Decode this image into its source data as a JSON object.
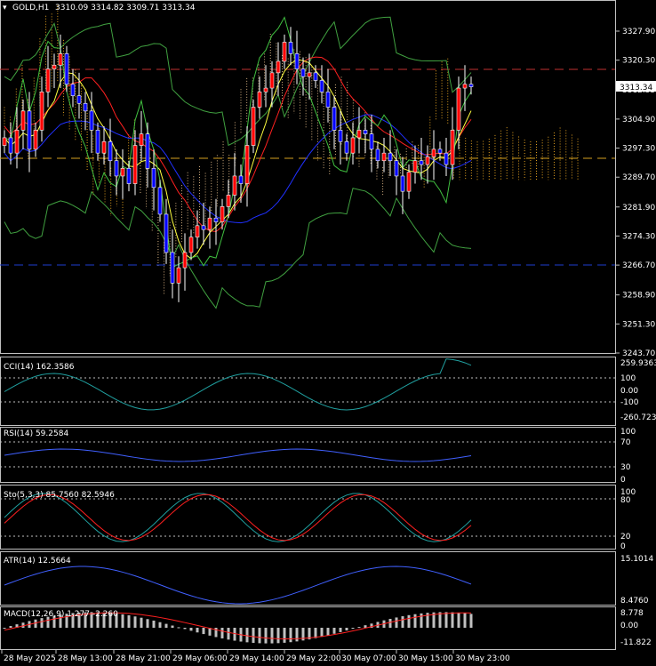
{
  "header": {
    "symbol": "GOLD,H1",
    "ohlc": "3310.09 3314.82 3309.71 3313.34"
  },
  "main_axis": {
    "ticks": [
      "3327.90",
      "3320.30",
      "3312.55",
      "3304.90",
      "3297.30",
      "3289.70",
      "3281.90",
      "3274.30",
      "3266.70",
      "3258.90",
      "3251.30",
      "3243.70"
    ],
    "current_price": "3313.34"
  },
  "indicators": {
    "cci": {
      "label": "CCI(14) 162.3586",
      "ticks": [
        "259.9363",
        "100",
        "0.00",
        "-100",
        "-260.7236"
      ]
    },
    "rsi": {
      "label": "RSI(14) 59.2584",
      "ticks": [
        "100",
        "70",
        "30",
        "0"
      ]
    },
    "stoch": {
      "label": "Sto(5,3,3) 85.7560 82.5946",
      "ticks": [
        "100",
        "80",
        "20",
        "0"
      ]
    },
    "atr": {
      "label": "ATR(14) 12.5664",
      "ticks": [
        "15.1014",
        "8.4760"
      ]
    },
    "macd": {
      "label": "MACD(12,26,9) 1.277 -2.260",
      "ticks": [
        "8.778",
        "0.00",
        "-11.822"
      ]
    }
  },
  "time_axis": [
    "28 May 2025",
    "28 May 13:00",
    "28 May 21:00",
    "29 May 06:00",
    "29 May 14:00",
    "29 May 22:00",
    "30 May 07:00",
    "30 May 15:00",
    "30 May 23:00"
  ],
  "colors": {
    "bull": "#ff0000",
    "bear": "#0000ff",
    "grid": "#c0c0c0"
  },
  "chart_data": {
    "type": "candlestick",
    "closes": [
      3300,
      3296,
      3302,
      3307,
      3297,
      3302,
      3312,
      3318,
      3319,
      3322,
      3314,
      3311,
      3309,
      3307,
      3302,
      3296,
      3299,
      3294,
      3290,
      3292,
      3288,
      3298,
      3301,
      3292,
      3287,
      3280,
      3270,
      3262,
      3266,
      3270,
      3274,
      3277,
      3276,
      3279,
      3278,
      3282,
      3285,
      3290,
      3288,
      3298,
      3308,
      3312,
      3313,
      3317,
      3320,
      3325,
      3322,
      3318,
      3316,
      3317,
      3315,
      3312,
      3308,
      3302,
      3299,
      3296,
      3300,
      3302,
      3301,
      3297,
      3294,
      3296,
      3294,
      3290,
      3286,
      3291,
      3294,
      3293,
      3295,
      3297,
      3296,
      3293,
      3302,
      3313,
      3314,
      3313.34
    ]
  }
}
